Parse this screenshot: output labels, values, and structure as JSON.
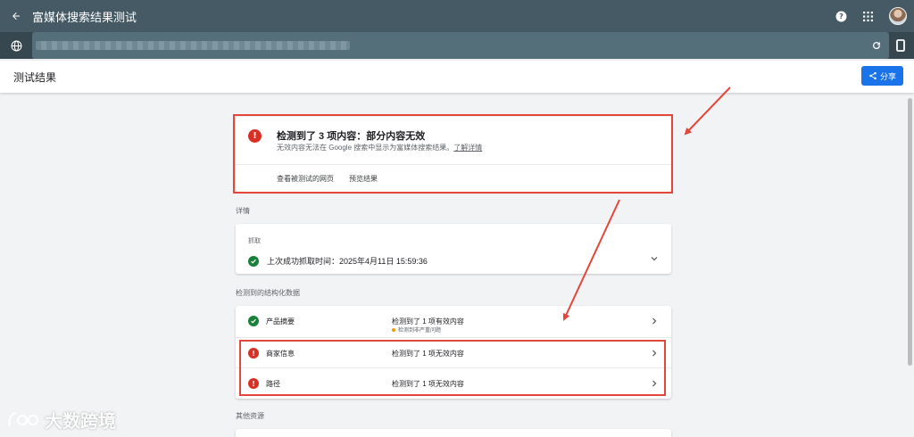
{
  "appbar": {
    "title": "富媒体搜索结果测试"
  },
  "subheader": {
    "title": "测试结果",
    "share_label": "分享"
  },
  "summary": {
    "heading": "检测到了 3 项内容：部分内容无效",
    "subtitle": "无效内容无法在 Google 搜索中显示为富媒体搜索结果。",
    "learn_more": "了解详情",
    "view_tested_page": "查看被测试的网页",
    "preview_results": "预览结果"
  },
  "details": {
    "section_label": "详情",
    "crawl_label": "抓取",
    "crawl_status": "上次成功抓取时间：2025年4月11日 15:59:36"
  },
  "structured_data": {
    "section_label": "检测到的结构化数据",
    "rows": [
      {
        "name": "产品摘要",
        "status": "检测到了 1 项有效内容",
        "note": "检测到非严重问题"
      },
      {
        "name": "商家信息",
        "status": "检测到了 1 项无效内容"
      },
      {
        "name": "路径",
        "status": "检测到了 1 项无效内容"
      }
    ]
  },
  "other_resources": {
    "section_label": "其他资源"
  },
  "watermark": {
    "text": "大数跨境"
  },
  "colors": {
    "appbar": "#455a64",
    "accent": "#1a73e8",
    "error": "#d93025",
    "success": "#188038",
    "annotation": "#e5463a"
  },
  "icons": [
    "back-arrow-icon",
    "help-icon",
    "apps-grid-icon",
    "globe-icon",
    "refresh-icon",
    "mobile-device-icon",
    "share-icon",
    "error-icon",
    "check-circle-icon",
    "chevron-down-icon",
    "chevron-right-icon",
    "warning-dot-icon"
  ]
}
